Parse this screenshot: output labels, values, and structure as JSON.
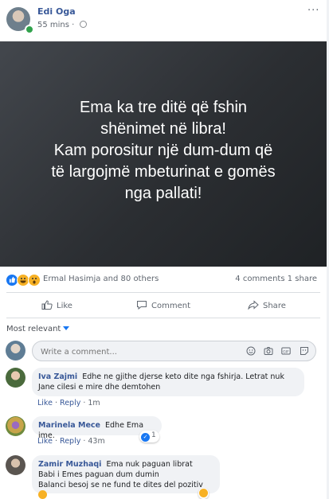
{
  "post": {
    "author": "Edi Oga",
    "time": "55 mins",
    "more": "···",
    "text_lines": [
      "Ema ka tre ditë që fshin",
      "shënimet në libra!",
      "Kam porositur një dum-dum që",
      "të largojmë mbeturinat e gomës",
      "nga pallati!"
    ],
    "banner_color": "#2f3236"
  },
  "stats": {
    "reactors": "Ermal Hasimja and 80 others",
    "comments_shares": "4 comments  1 share",
    "reactions": [
      "like-icon",
      "haha-icon",
      "wow-icon"
    ]
  },
  "actions": {
    "like": "Like",
    "comment": "Comment",
    "share": "Share"
  },
  "sort": {
    "label": "Most relevant"
  },
  "composer": {
    "placeholder": "Write a comment...",
    "icons": [
      "emoji-icon",
      "camera-icon",
      "gif-icon",
      "sticker-icon"
    ]
  },
  "comments": [
    {
      "name": "Iva Zajmi",
      "text": "Edhe ne gjithe djerse keto dite nga fshirja. Letrat nuk Jane cilesi e mire dhe demtohen",
      "like": "Like",
      "reply": "Reply",
      "time": "1m"
    },
    {
      "name": "Marinela Mece",
      "text": "Edhe Ema ime.",
      "like": "Like",
      "reply": "Reply",
      "time": "43m",
      "reaction_count": "1"
    },
    {
      "name": "Zamir Muzhaqi",
      "text_lines": [
        "Ema nuk paguan librat",
        "Babi i Emes paguan dum dumin",
        "Balanci besoj se ne fund te dites del pozitiv"
      ]
    }
  ],
  "colors": {
    "accent": "#1877f2",
    "link": "#385898",
    "bubble": "#f0f2f5"
  }
}
